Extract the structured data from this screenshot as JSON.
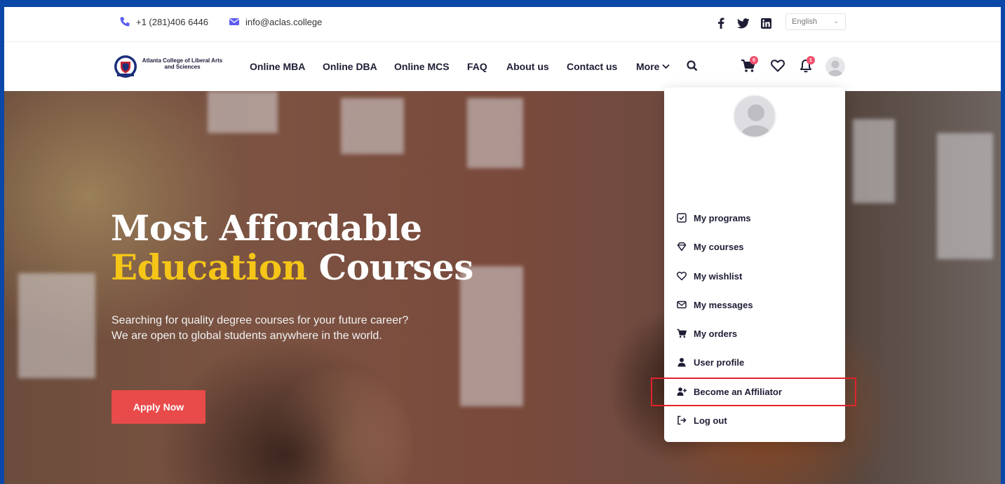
{
  "topbar": {
    "phone": "+1 (281)406 6446",
    "email": "info@aclas.college",
    "language": "English"
  },
  "nav": {
    "logo_text": "Atlanta College of Liberal Arts and Sciences",
    "links": [
      "Online MBA",
      "Online DBA",
      "Online MCS",
      "FAQ",
      "About us",
      "Contact us"
    ],
    "more": "More",
    "cart_badge": "0",
    "notif_badge": "1"
  },
  "hero": {
    "title_line1": "Most Affordable",
    "title_highlight": "Education",
    "title_rest": " Courses",
    "description": "Searching for quality degree courses for your future career? We are open to global students anywhere in the world.",
    "cta": "Apply Now"
  },
  "dropdown": {
    "items": [
      "My programs",
      "My courses",
      "My wishlist",
      "My messages",
      "My orders",
      "User profile",
      "Become an Affiliator",
      "Log out"
    ]
  },
  "colors": {
    "background": "#0a47a8",
    "accent_yellow": "#f5c518",
    "cta_red": "#e94a4a",
    "highlight_red": "#e0232e",
    "phone_icon": "#5b5cf0"
  }
}
